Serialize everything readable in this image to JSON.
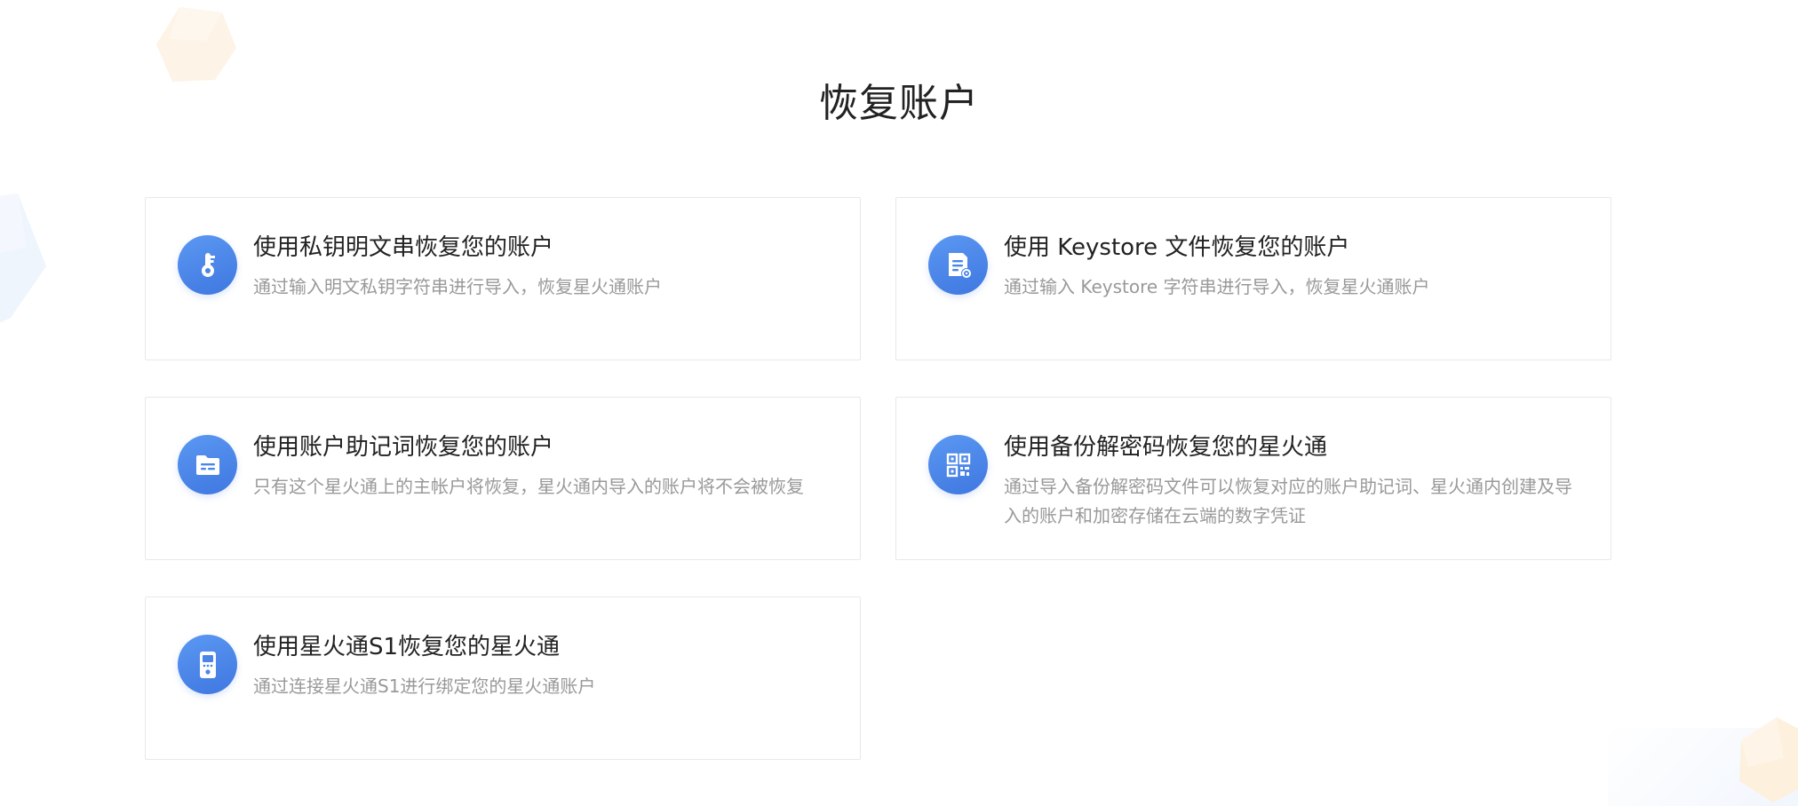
{
  "page": {
    "title": "恢复账户"
  },
  "options": [
    {
      "title": "使用私钥明文串恢复您的账户",
      "description": "通过输入明文私钥字符串进行导入，恢复星火通账户",
      "icon": "key-icon"
    },
    {
      "title": "使用 Keystore 文件恢复您的账户",
      "description": "通过输入 Keystore 字符串进行导入，恢复星火通账户",
      "icon": "keystore-file-icon"
    },
    {
      "title": "使用账户助记词恢复您的账户",
      "description": "只有这个星火通上的主帐户将恢复，星火通内导入的账户将不会被恢复",
      "icon": "mnemonic-folder-icon"
    },
    {
      "title": "使用备份解密码恢复您的星火通",
      "description": "通过导入备份解密码文件可以恢复对应的账户助记词、星火通内创建及导入的账户和加密存储在云端的数字凭证",
      "icon": "qr-code-icon"
    },
    {
      "title": "使用星火通S1恢复您的星火通",
      "description": "通过连接星火通S1进行绑定您的星火通账户",
      "icon": "hardware-device-icon"
    }
  ],
  "colors": {
    "accent": "#4a86e8",
    "title_text": "#222222",
    "description_text": "#999999",
    "card_border": "#e6e8ec"
  }
}
